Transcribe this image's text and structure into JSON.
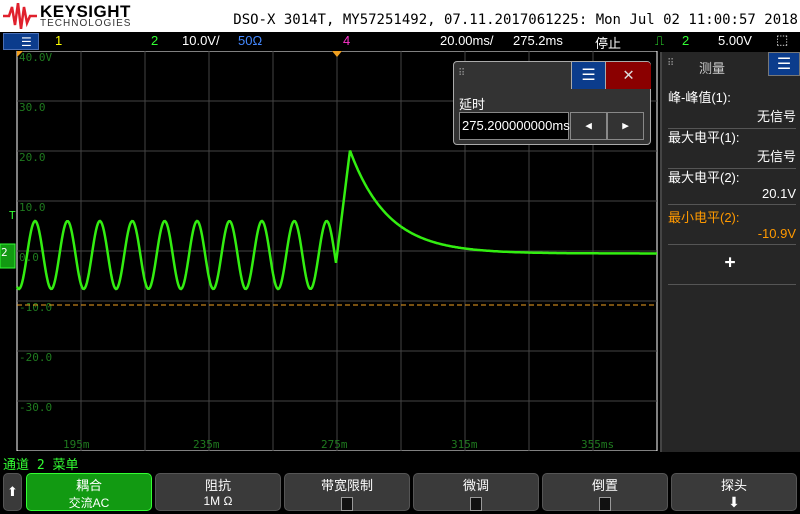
{
  "header": {
    "brand": "KEYSIGHT",
    "brand_sub": "TECHNOLOGIES",
    "instrument_info": "DSO-X 3014T, MY57251492, 07.11.2017061225: Mon Jul 02 11:00:57 2018"
  },
  "status": {
    "ch1": "1",
    "ch2": "2",
    "ch2_scale": "10.0V/",
    "ch2_impedance": "50Ω",
    "ch4": "4",
    "timebase": "20.00ms/",
    "delay": "275.2ms",
    "run_state": "停止",
    "trigger_source": "2",
    "trigger_level": "5.00V"
  },
  "plot": {
    "y_labels": [
      "40.0V",
      "30.0",
      "20.0",
      "10.0",
      "0.0",
      "-10.0",
      "-20.0",
      "-30.0"
    ],
    "x_labels": [
      "195m",
      "235m",
      "275m",
      "315m",
      "355ms"
    ],
    "trace_color": "#33ee11",
    "trigger_level_color": "#f0a020"
  },
  "dialog": {
    "label": "延时",
    "value": "275.200000000ms"
  },
  "measure": {
    "title": "测量",
    "items": [
      {
        "label": "峰-峰值(1):",
        "value": "无信号"
      },
      {
        "label": "最大电平(1):",
        "value": "无信号"
      },
      {
        "label": "最大电平(2):",
        "value": "20.1V"
      },
      {
        "label": "最小电平(2):",
        "value": "-10.9V",
        "highlight": "#ff9900"
      }
    ],
    "add": "+"
  },
  "channel_menu": "通道 2 菜单",
  "softkeys": [
    {
      "title": "耦合",
      "value": "交流AC"
    },
    {
      "title": "阻抗",
      "value": "1M Ω"
    },
    {
      "title": "带宽限制"
    },
    {
      "title": "微调"
    },
    {
      "title": "倒置"
    },
    {
      "title": "探头"
    }
  ]
}
